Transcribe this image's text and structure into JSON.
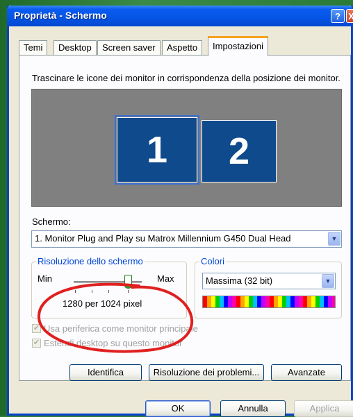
{
  "window": {
    "title": "Proprietà - Schermo",
    "help_label": "?",
    "close_label": "X"
  },
  "tabs": [
    {
      "label": "Temi"
    },
    {
      "label": "Desktop"
    },
    {
      "label": "Screen saver"
    },
    {
      "label": "Aspetto"
    },
    {
      "label": "Impostazioni",
      "active": true
    }
  ],
  "panel": {
    "instruction": "Trascinare le icone dei monitor in corrispondenza della posizione dei monitor.",
    "monitors": [
      "1",
      "2"
    ],
    "schermo_label": "Schermo:",
    "monitor_value": "1. Monitor Plug and Play su Matrox Millennium G450 Dual Head",
    "resolution": {
      "legend": "Risoluzione dello schermo",
      "min_label": "Min",
      "max_label": "Max",
      "value_text": "1280 per 1024 pixel",
      "slider_fraction": 0.75
    },
    "colors": {
      "legend": "Colori",
      "value": "Massima (32 bit)"
    },
    "checkbox_primary": "Usa periferica come monitor principale",
    "checkbox_extend": "Estendi desktop su questo monitor",
    "buttons": {
      "identifica": "Identifica",
      "problemi": "Risoluzione dei problemi...",
      "avanzate": "Avanzate"
    }
  },
  "footer": {
    "ok": "OK",
    "annulla": "Annulla",
    "applica": "Applica"
  },
  "colors": {
    "title_bar": "#0454e6",
    "monitor_fill": "#0f4a8c",
    "group_legend": "#0046d5",
    "annotation": "#e02020"
  }
}
